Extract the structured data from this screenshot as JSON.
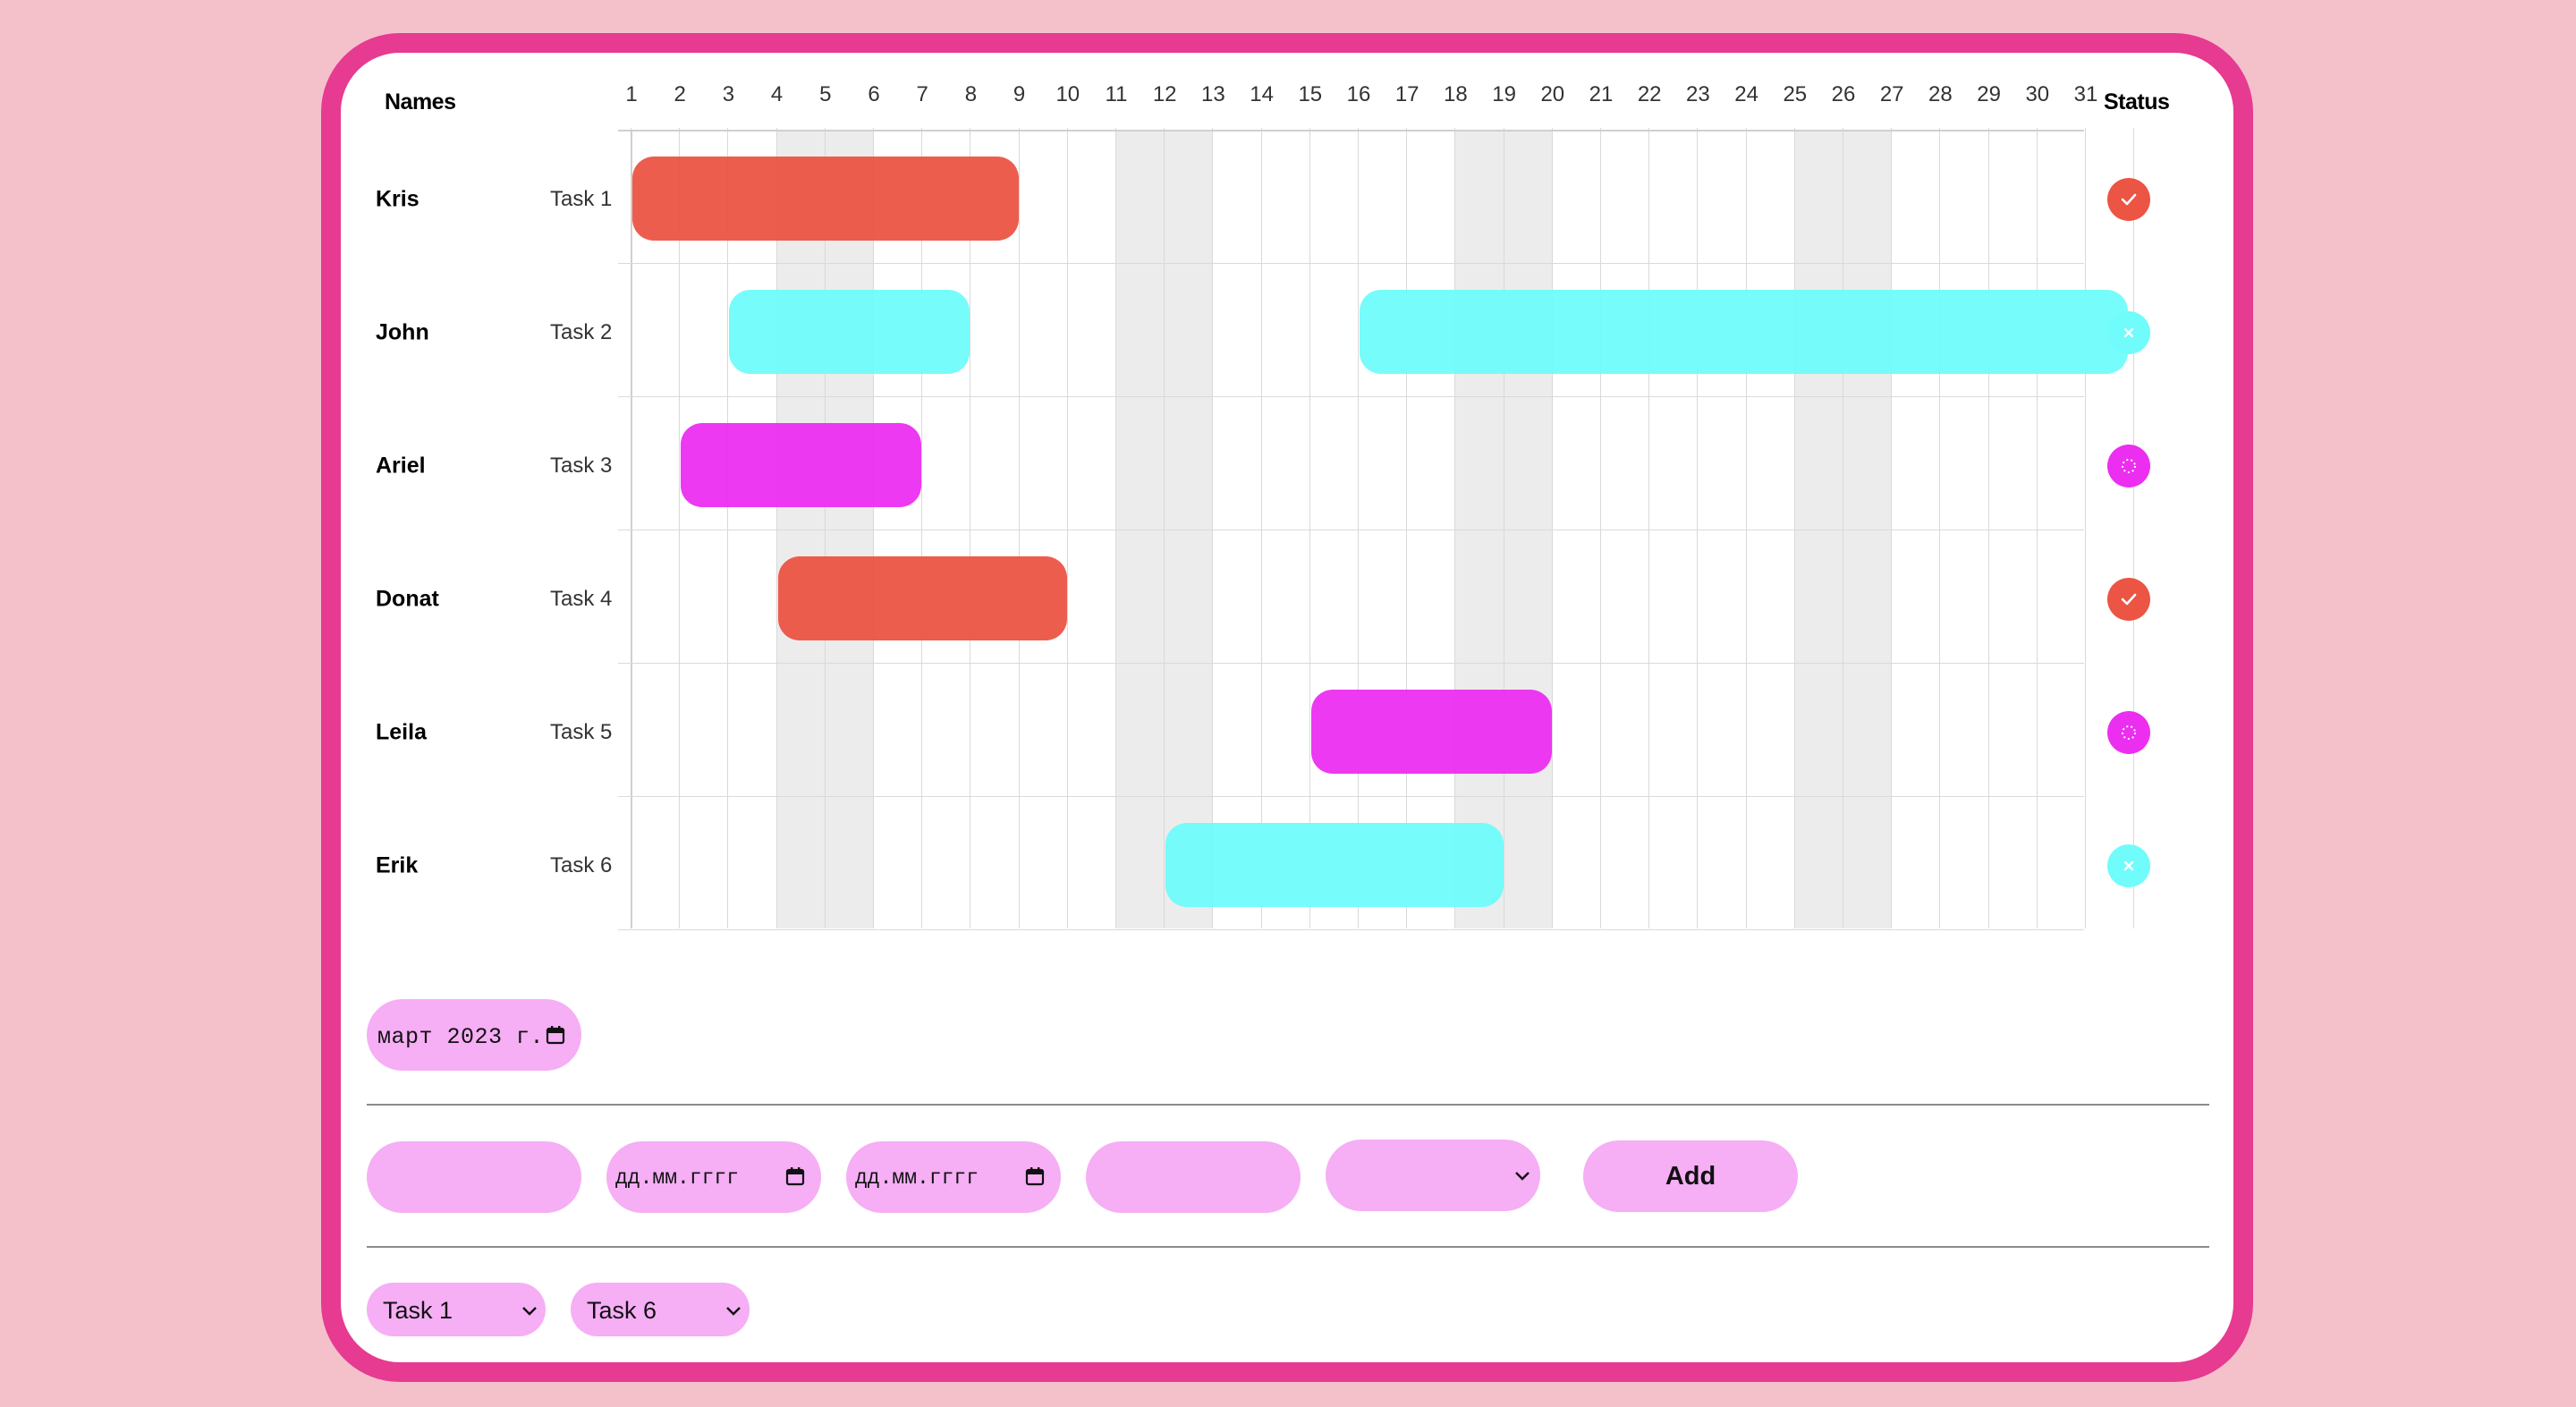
{
  "header": {
    "names": "Names",
    "status": "Status"
  },
  "days": [
    "1",
    "2",
    "3",
    "4",
    "5",
    "6",
    "7",
    "8",
    "9",
    "10",
    "11",
    "12",
    "13",
    "14",
    "15",
    "16",
    "17",
    "18",
    "19",
    "20",
    "21",
    "22",
    "23",
    "24",
    "25",
    "26",
    "27",
    "28",
    "29",
    "30",
    "31"
  ],
  "weekend_days": [
    4,
    5,
    11,
    12,
    18,
    19,
    25,
    26
  ],
  "rows": [
    {
      "name": "Kris",
      "task": "Task 1",
      "start": 1,
      "end": 8,
      "color": "#ec5444",
      "status": "done"
    },
    {
      "name": "John",
      "task": "Task 2",
      "start": 3,
      "end": 7,
      "color": "#6ffcfb",
      "status": "cancelled",
      "extra": {
        "start": 16,
        "end": 31
      }
    },
    {
      "name": "Ariel",
      "task": "Task 3",
      "start": 2,
      "end": 6,
      "color": "#ec2ef0",
      "status": "in-progress"
    },
    {
      "name": "Donat",
      "task": "Task 4",
      "start": 4,
      "end": 9,
      "color": "#ec5444",
      "status": "done"
    },
    {
      "name": "Leila",
      "task": "Task 5",
      "start": 15,
      "end": 19,
      "color": "#ec2ef0",
      "status": "in-progress"
    },
    {
      "name": "Erik",
      "task": "Task 6",
      "start": 12,
      "end": 18,
      "color": "#6ffcfb",
      "status": "cancelled"
    }
  ],
  "month_picker": {
    "value": "март 2023 г."
  },
  "form": {
    "name_value": "",
    "start_date_placeholder": "дд.мм.гггг",
    "end_date_placeholder": "дд.мм.гггг",
    "task_value": "",
    "status_value": "",
    "add_label": "Add"
  },
  "task_selects": [
    "Task 1",
    "Task 6"
  ],
  "colors": {
    "background": "#f4c1cb",
    "frame": "#e73a91",
    "pill": "#f6aef5",
    "done": "#ec5444",
    "cancelled": "#6ffcfb",
    "in_progress": "#ec2ef0"
  }
}
